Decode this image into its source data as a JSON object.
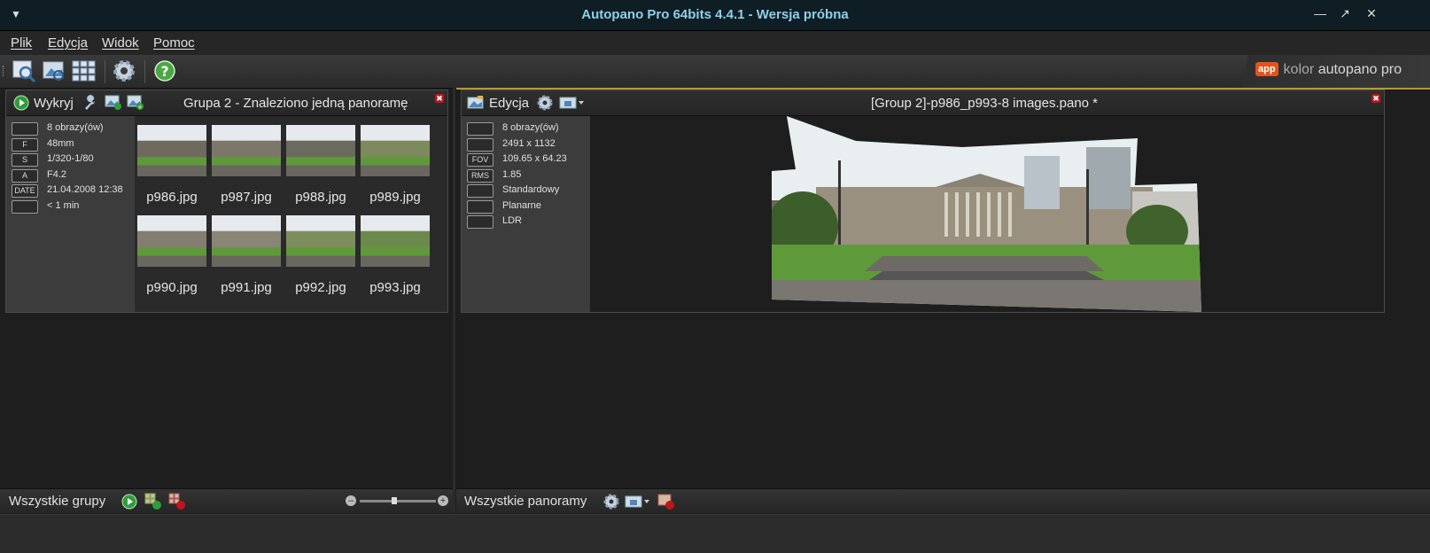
{
  "window": {
    "title": "Autopano Pro 64bits 4.4.1 - Wersja próbna"
  },
  "menu": {
    "plik": "Plik",
    "edycja": "Edycja",
    "widok": "Widok",
    "pomoc": "Pomoc"
  },
  "toolbar": {
    "icons": [
      "select-images-icon",
      "detect-icon",
      "batch-icon",
      "settings-gear-icon",
      "help-icon"
    ]
  },
  "brand": {
    "logo": "app",
    "kolor": "kolor",
    "name": "autopano pro"
  },
  "group_panel": {
    "detect_label": "Wykryj",
    "title": "Grupa 2 - Znaleziono jedną panoramę",
    "info": [
      {
        "badge": "",
        "text": "8 obrazy(ów)"
      },
      {
        "badge": "F",
        "text": "48mm"
      },
      {
        "badge": "S",
        "text": "1/320-1/80"
      },
      {
        "badge": "A",
        "text": "F4.2"
      },
      {
        "badge": "DATE",
        "text": "21.04.2008 12:38"
      },
      {
        "badge": "",
        "text": "< 1 min"
      }
    ],
    "thumbs": [
      "p986.jpg",
      "p987.jpg",
      "p988.jpg",
      "p989.jpg",
      "p990.jpg",
      "p991.jpg",
      "p992.jpg",
      "p993.jpg"
    ]
  },
  "pano_panel": {
    "edit_label": "Edycja",
    "title": "[Group 2]-p986_p993-8 images.pano *",
    "info": [
      {
        "badge": "",
        "text": "8 obrazy(ów)"
      },
      {
        "badge": "",
        "text": "2491 x 1132"
      },
      {
        "badge": "FOV",
        "text": "109.65 x 64.23"
      },
      {
        "badge": "RMS",
        "text": "1.85"
      },
      {
        "badge": "",
        "text": "Standardowy"
      },
      {
        "badge": "",
        "text": "Planarne"
      },
      {
        "badge": "",
        "text": "LDR"
      }
    ]
  },
  "bottom_left": {
    "label": "Wszystkie grupy",
    "zoom_level": 0.45
  },
  "bottom_right": {
    "label": "Wszystkie panoramy"
  },
  "colors": {
    "accent": "#8fd0e8",
    "close": "#c0151b",
    "grass": "#5f9a3a",
    "stone": "#8a8070"
  }
}
